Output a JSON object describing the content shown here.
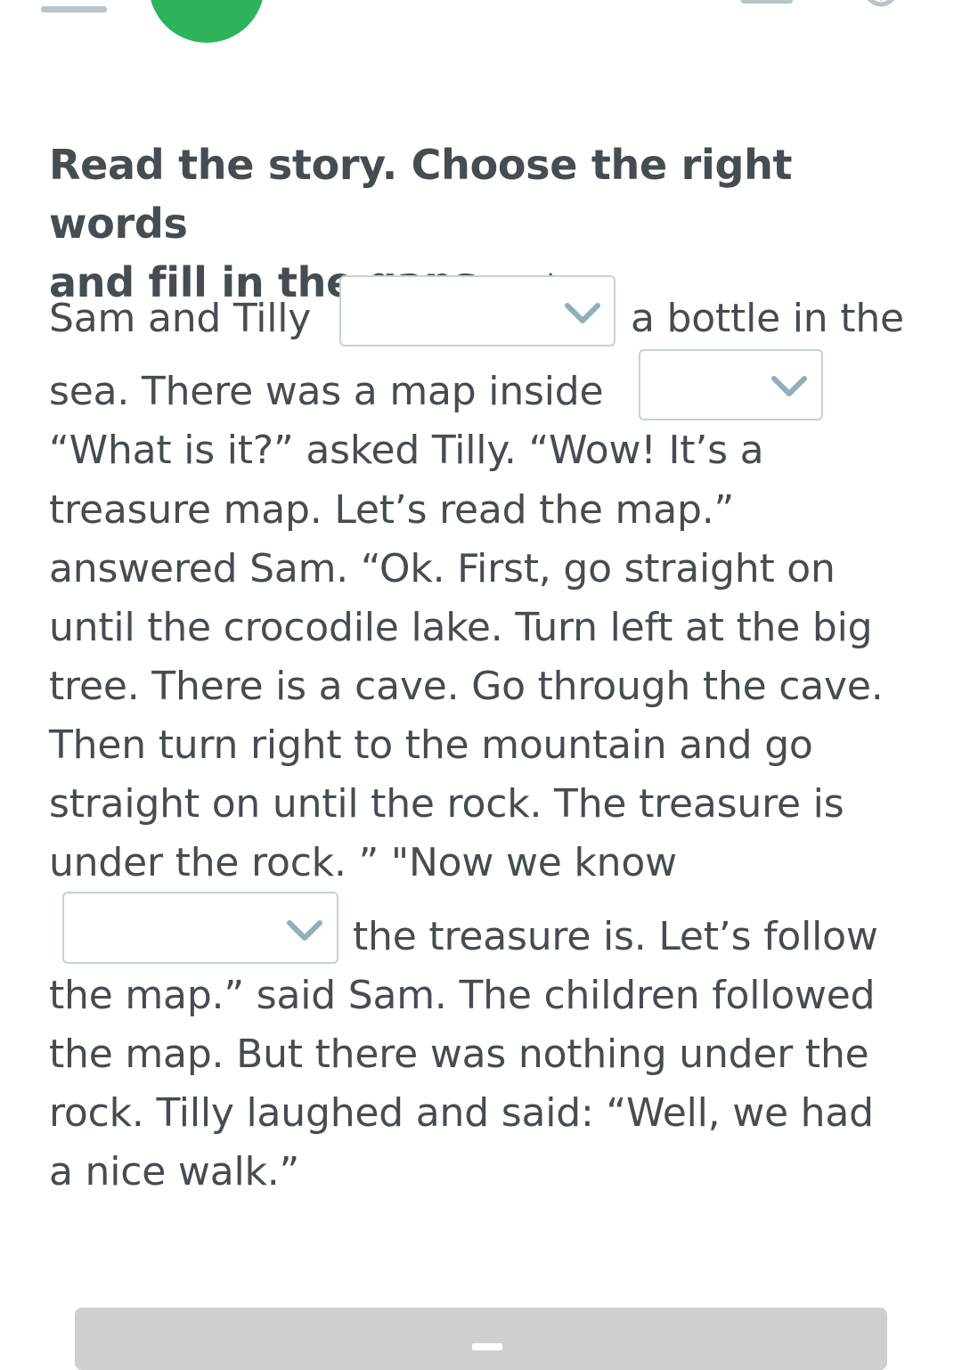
{
  "header": {
    "accent_color": "#2db35b",
    "audio_icon": "speaker-icon"
  },
  "task": {
    "instruction_line1": "Read the story. Choose the right words",
    "instruction_line2": "and fill in the gaps."
  },
  "story": {
    "l1_a": "Sam and Tilly",
    "l1_b": "a bottle in the",
    "l2_a": "sea. There was a map inside",
    "l3": " “What is it?” asked Tilly. “Wow! It’s a",
    "l4": "treasure map. Let’s read the map.”",
    "l5": "answered Sam. “Ok. First, go straight on",
    "l6": "until the crocodile lake. Turn left at the big",
    "l7": "tree. There is a cave. Go through the cave.",
    "l8": "Then turn right to the mountain and go",
    "l9": "straight on until the rock. The treasure is",
    "l10": "under the rock. ” \"Now we know",
    "l11_b": "the treasure is. Let’s follow",
    "l12": "the map.” said Sam. The children followed",
    "l13": "the map. But there was nothing under the",
    "l14": "rock. Tilly laughed and said: “Well, we had",
    "l15": "a nice walk.”"
  },
  "gaps": [
    {
      "selected": "",
      "icon": "chevron-down-icon"
    },
    {
      "selected": "",
      "icon": "chevron-down-icon"
    },
    {
      "selected": "",
      "icon": "chevron-down-icon"
    }
  ],
  "colors": {
    "text": "#454c52",
    "gap_border": "#c5d2d8",
    "chevron": "#8fb0b8",
    "submit_bg": "#cfcfcf"
  }
}
